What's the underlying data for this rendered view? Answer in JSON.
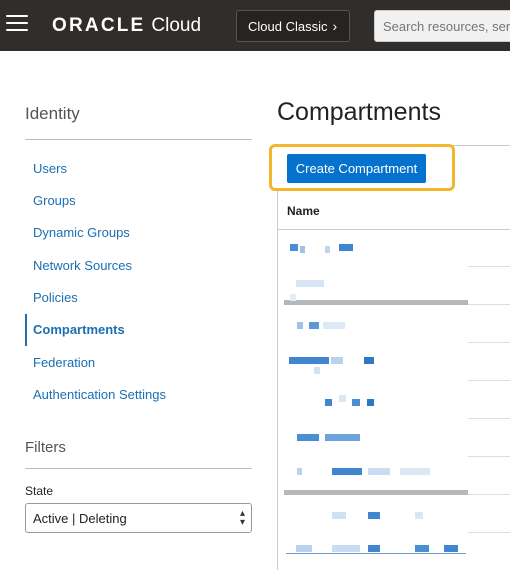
{
  "header": {
    "menu_icon": "hamburger-menu-icon",
    "logo_brand": "ORACLE",
    "logo_product": "Cloud",
    "classic_label": "Cloud Classic",
    "classic_icon": "chevron-right-icon",
    "search_placeholder": "Search resources, serv"
  },
  "sidebar": {
    "title": "Identity",
    "items": [
      {
        "label": "Users"
      },
      {
        "label": "Groups"
      },
      {
        "label": "Dynamic Groups"
      },
      {
        "label": "Network Sources"
      },
      {
        "label": "Policies"
      },
      {
        "label": "Compartments",
        "active": true
      },
      {
        "label": "Federation"
      },
      {
        "label": "Authentication Settings"
      }
    ]
  },
  "filters": {
    "title": "Filters",
    "state_label": "State",
    "state_value": "Active | Deleting"
  },
  "main": {
    "title": "Compartments",
    "create_button": "Create Compartment",
    "table": {
      "columns": [
        "Name"
      ]
    }
  },
  "colors": {
    "topbar": "#312d2a",
    "link": "#1b6fb3",
    "primary_button": "#0572ce",
    "highlight": "#f2b52b"
  }
}
